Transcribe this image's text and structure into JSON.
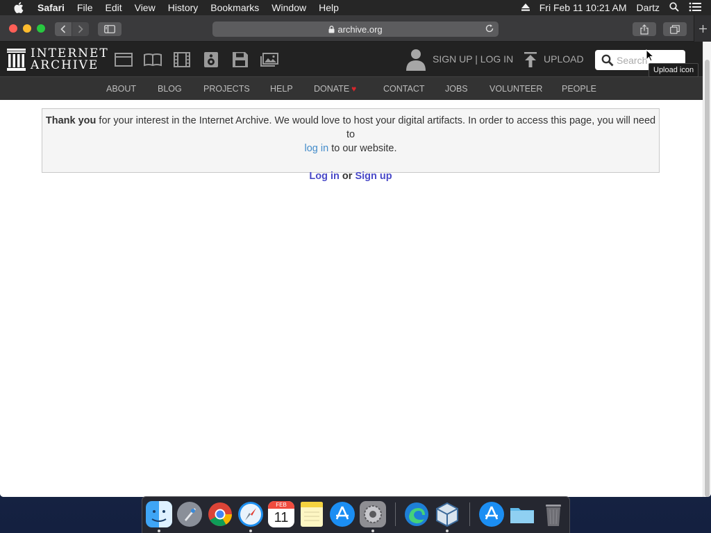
{
  "menubar": {
    "app": "Safari",
    "items": [
      "File",
      "Edit",
      "View",
      "History",
      "Bookmarks",
      "Window",
      "Help"
    ],
    "clock": "Fri Feb 11  10:21 AM",
    "user": "Dartz"
  },
  "browser": {
    "url": "archive.org"
  },
  "ia": {
    "logo_line1": "INTERNET",
    "logo_line2": "ARCHIVE",
    "signup": "SIGN UP | LOG IN",
    "upload": "UPLOAD",
    "search_placeholder": "Search",
    "nav": {
      "about": "ABOUT",
      "blog": "BLOG",
      "projects": "PROJECTS",
      "help": "HELP",
      "donate": "DONATE",
      "contact": "CONTACT",
      "jobs": "JOBS",
      "volunteer": "VOLUNTEER",
      "people": "PEOPLE"
    },
    "tooltip": "Upload icon"
  },
  "notice": {
    "bold_lead": "Thank you",
    "text1": " for your interest in the Internet Archive. We would love to host your digital artifacts. In order to access this page, you will need to",
    "login_link": "log in",
    "text2": " to our website.",
    "action_login": "Log in",
    "action_or": " or ",
    "action_signup": "Sign up"
  },
  "dock": {
    "calendar_month": "FEB",
    "calendar_day": "11"
  },
  "colors": {
    "ia_header": "#222222",
    "ia_nav": "#333333",
    "donate_heart": "#d8262c",
    "link": "#428bca"
  }
}
